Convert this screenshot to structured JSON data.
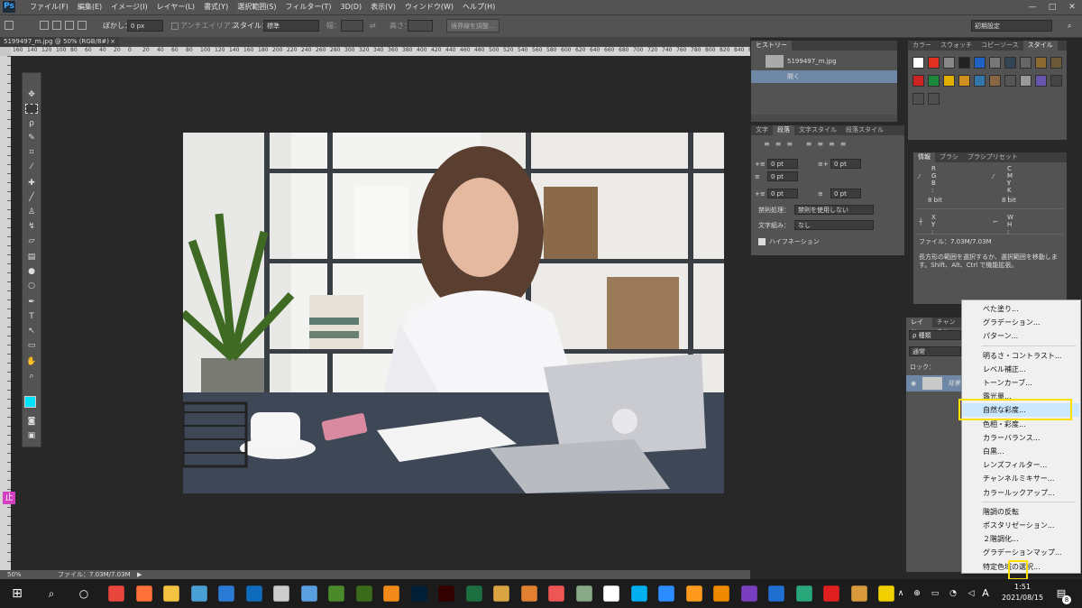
{
  "app": {
    "logo": "Ps"
  },
  "menubar": {
    "items": [
      "ファイル(F)",
      "編集(E)",
      "イメージ(I)",
      "レイヤー(L)",
      "書式(Y)",
      "選択範囲(S)",
      "フィルター(T)",
      "3D(D)",
      "表示(V)",
      "ウィンドウ(W)",
      "ヘルプ(H)"
    ],
    "window_controls": [
      "—",
      "□",
      "✕"
    ]
  },
  "options": {
    "feather_label": "ぼかし：",
    "feather_value": "0 px",
    "antialias_label": "アンチエイリアス",
    "style_label": "スタイル：",
    "style_value": "標準",
    "width_label": "幅：",
    "height_label": "高さ：",
    "refine_button": "境界線を調整...",
    "workspace": "初期設定"
  },
  "document": {
    "tab_title": "5199497_m.jpg @ 50% (RGB/8#)",
    "close_icon": "×",
    "zoom": "50%",
    "file_info": "ファイル：7.03M/7.03M"
  },
  "ruler": {
    "h_ticks": [
      "160",
      "140",
      "120",
      "100",
      "80",
      "60",
      "40",
      "20",
      "0",
      "20",
      "40",
      "60",
      "80",
      "100",
      "120",
      "140",
      "160",
      "180",
      "200",
      "220",
      "240",
      "260",
      "280",
      "300",
      "320",
      "340",
      "360",
      "380",
      "400",
      "420",
      "440",
      "460",
      "480",
      "500",
      "520",
      "540",
      "560",
      "580",
      "600",
      "620",
      "640",
      "660",
      "680",
      "700",
      "720",
      "740",
      "760",
      "780",
      "800",
      "820",
      "840",
      "860"
    ]
  },
  "history": {
    "tab": "ヒストリー",
    "snapshot_name": "5199497_m.jpg",
    "state_name": "開く"
  },
  "paragraph": {
    "tabs": [
      "文字",
      "段落",
      "文字スタイル",
      "段落スタイル"
    ],
    "active_tab": "段落",
    "indent_left": "0 pt",
    "indent_right": "0 pt",
    "indent_first": "0 pt",
    "space_before": "0 pt",
    "space_after": "0 pt",
    "kinsoku_label": "禁則処理：",
    "kinsoku_value": "禁則を使用しない",
    "mojikumi_label": "文字組み：",
    "mojikumi_value": "なし",
    "hyphenation_label": "ハイフネーション"
  },
  "swatches": {
    "tabs": [
      "カラー",
      "スウォッチ",
      "コピーソース",
      "スタイル"
    ],
    "active_tab": "スタイル",
    "colors": [
      "#ffffff",
      "#e03020",
      "#888888",
      "#222222",
      "#2060c0",
      "#777777",
      "#334455",
      "#666666",
      "#8a6a30",
      "#6a5a3a",
      "#cc2222",
      "#1a8a3a",
      "#e0b000",
      "#d09020",
      "#3377aa",
      "#886644",
      "#555555",
      "#999999",
      "#6655aa",
      "#444444",
      "#505050",
      "#505050"
    ]
  },
  "info": {
    "tabs": [
      "情報",
      "ブラシ",
      "ブラシプリセット"
    ],
    "active_tab": "情報",
    "rgb_labels": [
      "R :",
      "G :",
      "B :"
    ],
    "cmyk_labels": [
      "C :",
      "M :",
      "Y :",
      "K :"
    ],
    "bit_left": "8 bit",
    "bit_right": "8 bit",
    "xy_labels": [
      "X :",
      "Y :"
    ],
    "wh_labels": [
      "W :",
      "H :"
    ],
    "file_size": "ファイル：7.03M/7.03M",
    "hint": "長方形の範囲を選択するか、選択範囲を移動します。Shift、Alt、Ctrl で機能拡張。"
  },
  "layers": {
    "tabs": [
      "レイヤー",
      "チャンネル"
    ],
    "filter_label": "ρ 種類",
    "blend_mode": "通常",
    "lock_label": "ロック：",
    "layer_name": "背景"
  },
  "context_menu": {
    "groups": [
      [
        "べた塗り...",
        "グラデーション...",
        "パターン..."
      ],
      [
        "明るさ・コントラスト...",
        "レベル補正...",
        "トーンカーブ...",
        "露光量...",
        "自然な彩度...",
        "色相・彩度...",
        "カラーバランス...",
        "白黒...",
        "レンズフィルター...",
        "チャンネルミキサー...",
        "カラールックアップ..."
      ],
      [
        "階調の反転",
        "ポスタリゼーション...",
        "２階調化...",
        "グラデーションマップ...",
        "特定色域の選択..."
      ]
    ],
    "highlighted": "自然な彩度..."
  },
  "taskbar": {
    "time": "1:51",
    "date": "2021/08/15",
    "ime": "A",
    "notifications": "8",
    "apps": [
      {
        "name": "chrome",
        "color": "#e8453c"
      },
      {
        "name": "firefox",
        "color": "#ff7139"
      },
      {
        "name": "explorer",
        "color": "#f5c342"
      },
      {
        "name": "app-blue",
        "color": "#4aa0d5"
      },
      {
        "name": "photos",
        "color": "#2b7bd6"
      },
      {
        "name": "outlook",
        "color": "#0f6cbd"
      },
      {
        "name": "settings",
        "color": "#cccccc"
      },
      {
        "name": "screen",
        "color": "#5aa0e0"
      },
      {
        "name": "app-green",
        "color": "#4a8a2a"
      },
      {
        "name": "dreamweaver",
        "color": "#3a6b1a"
      },
      {
        "name": "sublime",
        "color": "#f28a1a"
      },
      {
        "name": "photoshop",
        "color": "#001e36"
      },
      {
        "name": "illustrator",
        "color": "#330000"
      },
      {
        "name": "excel",
        "color": "#1d6f42"
      },
      {
        "name": "pencil",
        "color": "#d9a441"
      },
      {
        "name": "butterfly",
        "color": "#e08030"
      },
      {
        "name": "paint",
        "color": "#e55"
      },
      {
        "name": "edit",
        "color": "#8a8"
      },
      {
        "name": "7zip",
        "color": "#ffffff"
      },
      {
        "name": "skype",
        "color": "#00aff0"
      },
      {
        "name": "zoom",
        "color": "#2d8cff"
      },
      {
        "name": "video",
        "color": "#ff9a1f"
      },
      {
        "name": "vlc",
        "color": "#f08a00"
      },
      {
        "name": "purple",
        "color": "#7a3fc0"
      },
      {
        "name": "music",
        "color": "#1f6fd0"
      },
      {
        "name": "globe",
        "color": "#2aa77a"
      },
      {
        "name": "record",
        "color": "#e02020"
      },
      {
        "name": "pet",
        "color": "#d89a3a"
      },
      {
        "name": "sticky",
        "color": "#f0d000"
      }
    ]
  }
}
